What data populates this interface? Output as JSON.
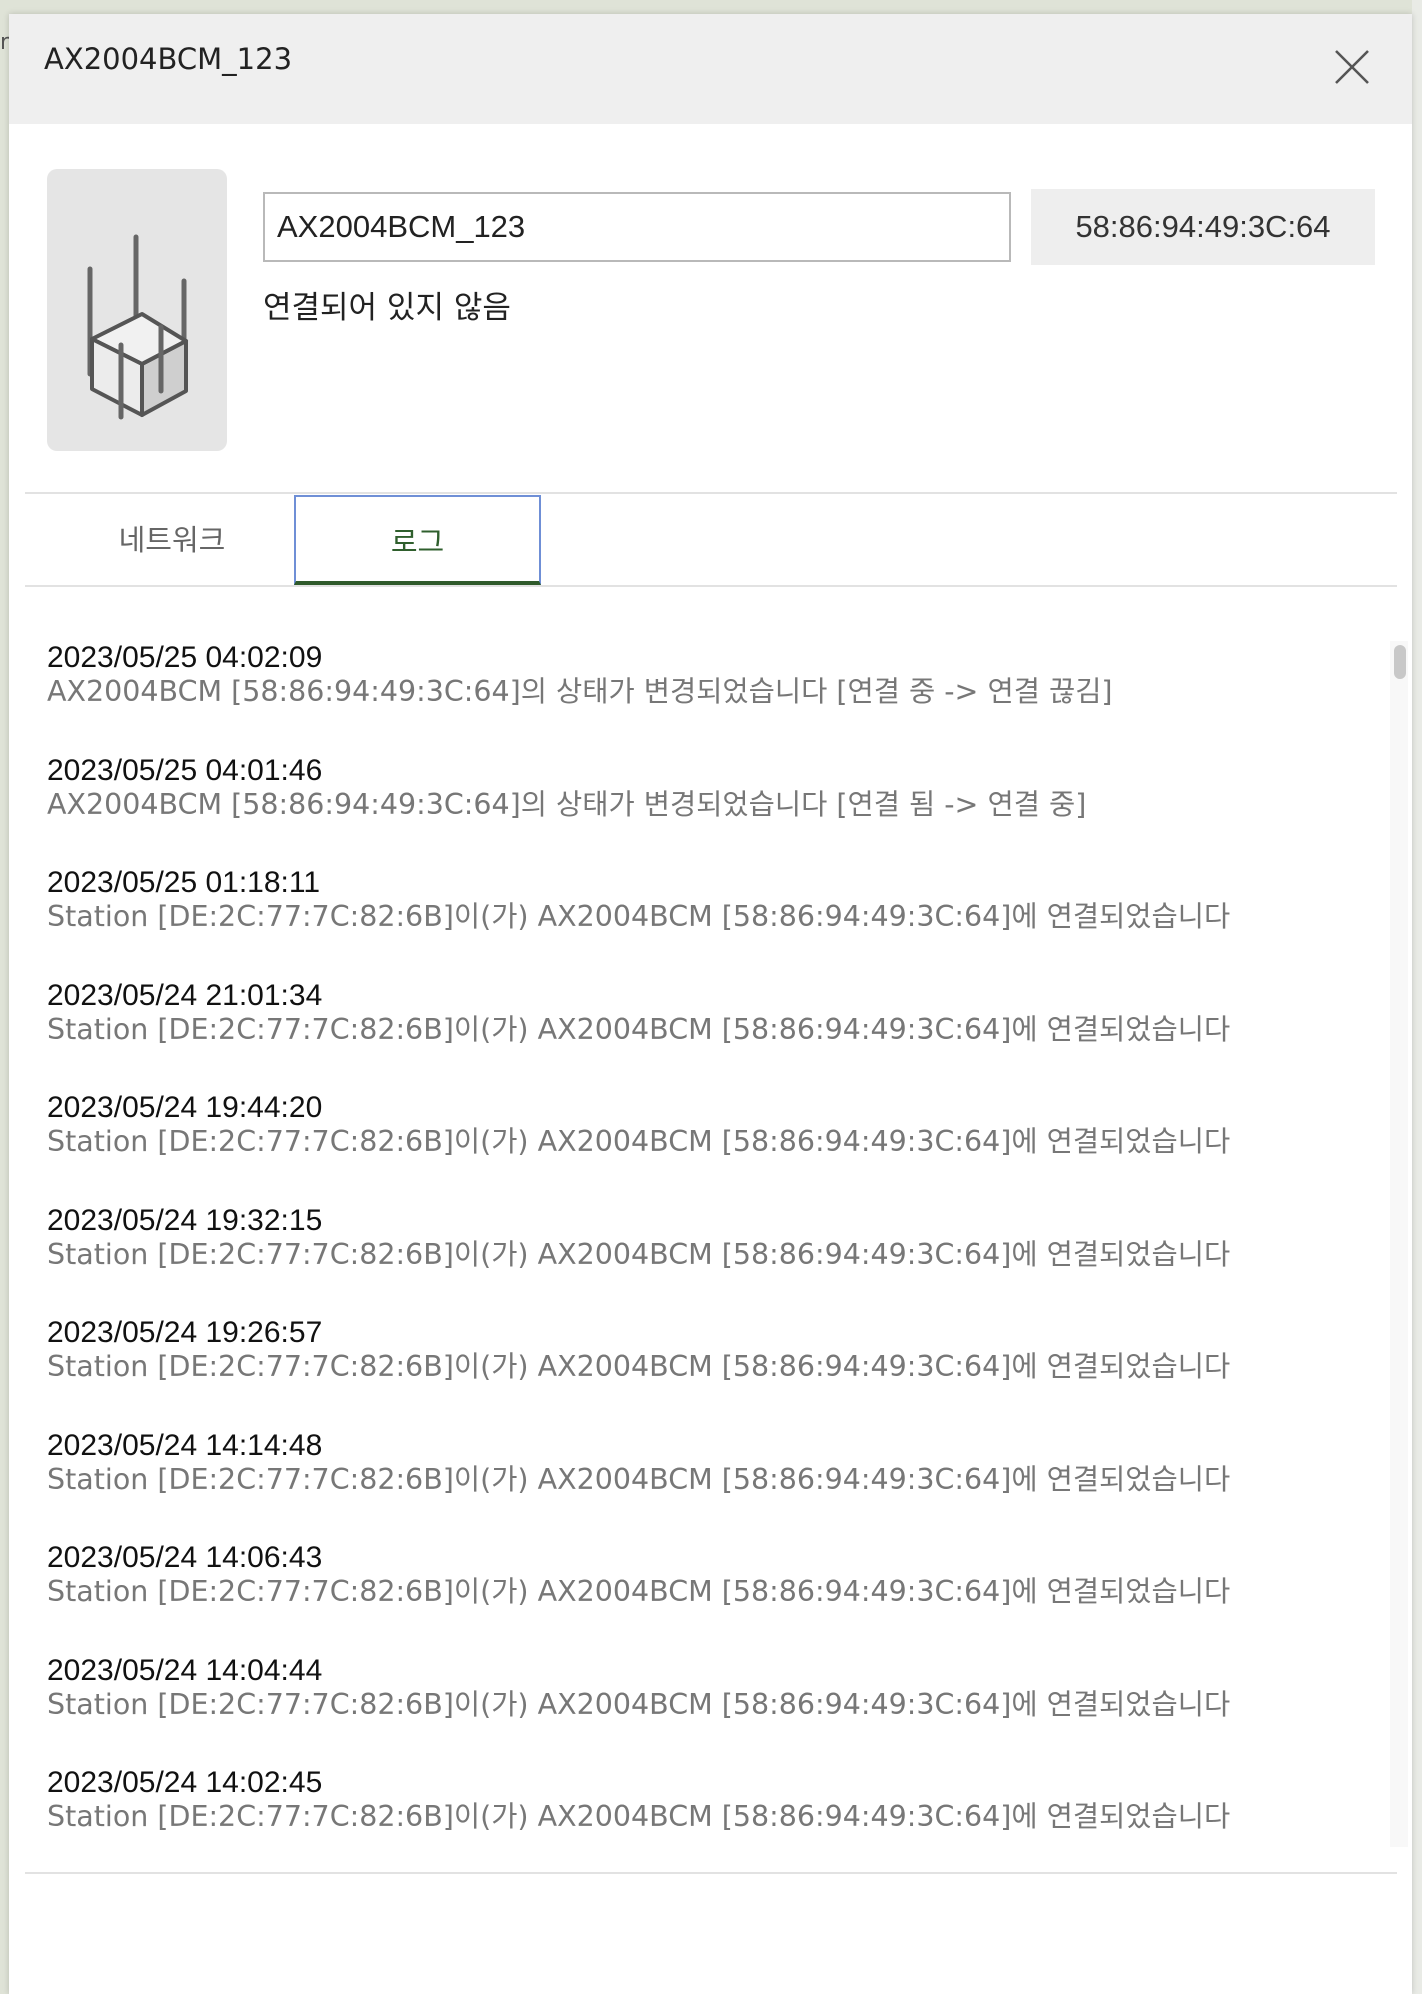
{
  "dialog": {
    "title": "AX2004BCM_123",
    "close_icon": "close-icon"
  },
  "device": {
    "image_icon": "router-icon",
    "name_value": "AX2004BCM_123",
    "mac": "58:86:94:49:3C:64",
    "status": "연결되어 있지 않음"
  },
  "tabs": [
    {
      "label": "네트워크",
      "active": false
    },
    {
      "label": "로그",
      "active": true
    }
  ],
  "logs": [
    {
      "time": "2023/05/25 04:02:09",
      "message": "AX2004BCM [58:86:94:49:3C:64]의 상태가 변경되었습니다 [연결 중 -> 연결 끊김]"
    },
    {
      "time": "2023/05/25 04:01:46",
      "message": "AX2004BCM [58:86:94:49:3C:64]의 상태가 변경되었습니다 [연결 됨 -> 연결 중]"
    },
    {
      "time": "2023/05/25 01:18:11",
      "message": "Station [DE:2C:77:7C:82:6B]이(가) AX2004BCM [58:86:94:49:3C:64]에 연결되었습니다"
    },
    {
      "time": "2023/05/24 21:01:34",
      "message": "Station [DE:2C:77:7C:82:6B]이(가) AX2004BCM [58:86:94:49:3C:64]에 연결되었습니다"
    },
    {
      "time": "2023/05/24 19:44:20",
      "message": "Station [DE:2C:77:7C:82:6B]이(가) AX2004BCM [58:86:94:49:3C:64]에 연결되었습니다"
    },
    {
      "time": "2023/05/24 19:32:15",
      "message": "Station [DE:2C:77:7C:82:6B]이(가) AX2004BCM [58:86:94:49:3C:64]에 연결되었습니다"
    },
    {
      "time": "2023/05/24 19:26:57",
      "message": "Station [DE:2C:77:7C:82:6B]이(가) AX2004BCM [58:86:94:49:3C:64]에 연결되었습니다"
    },
    {
      "time": "2023/05/24 14:14:48",
      "message": "Station [DE:2C:77:7C:82:6B]이(가) AX2004BCM [58:86:94:49:3C:64]에 연결되었습니다"
    },
    {
      "time": "2023/05/24 14:06:43",
      "message": "Station [DE:2C:77:7C:82:6B]이(가) AX2004BCM [58:86:94:49:3C:64]에 연결되었습니다"
    },
    {
      "time": "2023/05/24 14:04:44",
      "message": "Station [DE:2C:77:7C:82:6B]이(가) AX2004BCM [58:86:94:49:3C:64]에 연결되었습니다"
    },
    {
      "time": "2023/05/24 14:02:45",
      "message": "Station [DE:2C:77:7C:82:6B]이(가) AX2004BCM [58:86:94:49:3C:64]에 연결되었습니다"
    }
  ],
  "colors": {
    "header_bg": "#efefef",
    "active_tab_text": "#2f5f2d",
    "active_tab_border": "#6f8fd6",
    "log_message_text": "#777777"
  }
}
